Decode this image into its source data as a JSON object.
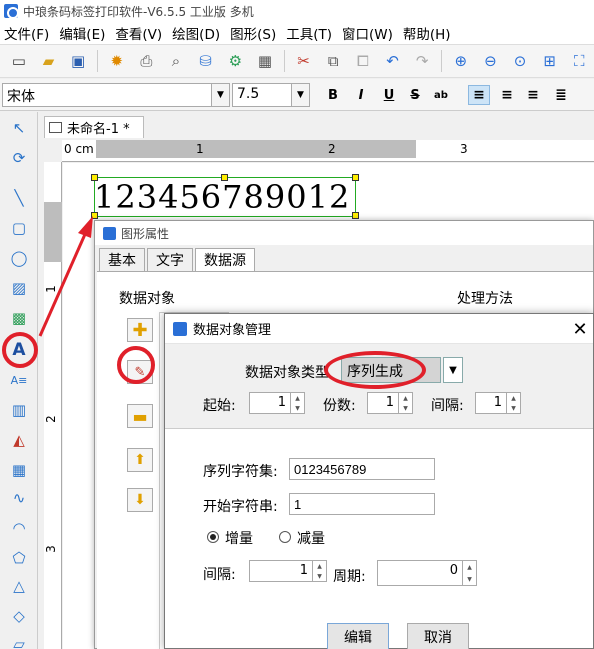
{
  "window": {
    "title": "中琅条码标签打印软件-V6.5.5 工业版 多机"
  },
  "menu": [
    "文件(F)",
    "编辑(E)",
    "查看(V)",
    "绘图(D)",
    "图形(S)",
    "工具(T)",
    "窗口(W)",
    "帮助(H)"
  ],
  "font_toolbar": {
    "font_name": "宋体",
    "font_size": "7.5",
    "bold": "B",
    "italic": "I",
    "underline": "U",
    "strike": "S",
    "spacing": "ab"
  },
  "document": {
    "tab_title": "未命名-1 *",
    "ruler_unit": "0 cm",
    "ruler_marks": [
      "1",
      "2",
      "3"
    ],
    "v_ruler_marks": [
      "1",
      "2",
      "3"
    ],
    "barcode_text": "123456789012"
  },
  "property_window": {
    "title": "图形属性",
    "tabs": [
      "基本",
      "文字",
      "数据源"
    ],
    "group_data_objects": "数据对象",
    "group_processing": "处理方法"
  },
  "data_dialog": {
    "title": "数据对象管理",
    "type_label": "数据对象类型",
    "type_value": "序列生成",
    "start_label": "起始:",
    "start_value": "1",
    "copies_label": "份数:",
    "copies_value": "1",
    "interval_label": "间隔:",
    "interval_value": "1",
    "charset_label": "序列字符集:",
    "charset_value": "0123456789",
    "start_string_label": "开始字符串:",
    "start_string_value": "1",
    "increase_label": "增量",
    "decrease_label": "减量",
    "step_label": "间隔:",
    "step_value": "1",
    "period_label": "周期:",
    "period_value": "0",
    "edit_button": "编辑",
    "cancel_button": "取消"
  },
  "colors": {
    "accent": "#2a6fd6",
    "annotation": "#e0202a",
    "selection": "#22aa22"
  }
}
